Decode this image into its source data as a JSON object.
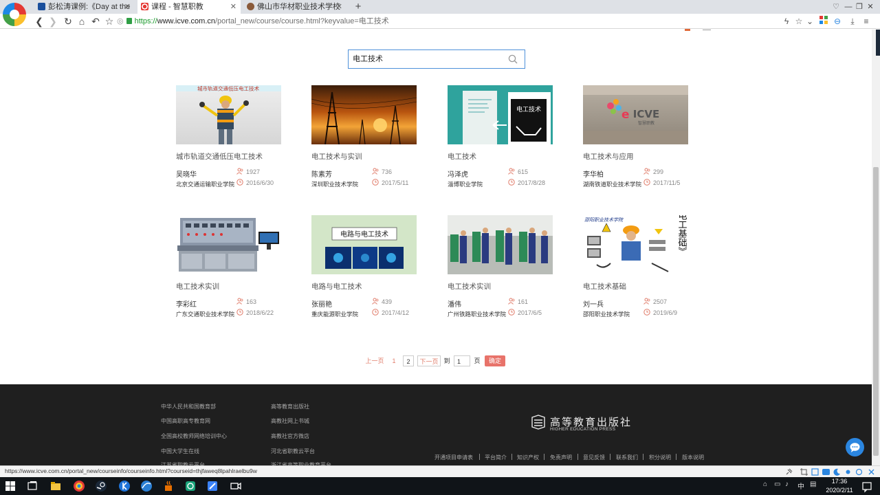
{
  "browser": {
    "tabs": [
      {
        "label": "彭松涛课例:《Day at the",
        "active": false
      },
      {
        "label": "课程 - 智慧职教",
        "active": true
      },
      {
        "label": "佛山市华材职业技术学校",
        "active": false
      }
    ],
    "url": {
      "scheme": "https://",
      "host": "www.icve.com.cn",
      "path": "/portal_new/course/course.html?keyvalue=电工技术"
    },
    "status_url": "https://www.icve.com.cn/portal_new/courseinfo/courseinfo.html?courseid=thjfaweq8lpahlraelbu9w"
  },
  "search": {
    "value": "电工技术"
  },
  "courses": [
    {
      "title": "城市轨道交通低压电工技术",
      "teacher": "吴晓华",
      "school": "北京交通运输职业学院",
      "views": "1927",
      "date": "2016/6/30",
      "banner": "城市轨道交通低压电工技术"
    },
    {
      "title": "电工技术与实训",
      "teacher": "陈素芳",
      "school": "深圳职业技术学院",
      "views": "736",
      "date": "2017/5/11"
    },
    {
      "title": "电工技术",
      "teacher": "冯泽虎",
      "school": "淄博职业学院",
      "views": "615",
      "date": "2017/8/28",
      "cover_text": "电工技术"
    },
    {
      "title": "电工技术与应用",
      "teacher": "李华柏",
      "school": "湖南铁道职业技术学院",
      "views": "299",
      "date": "2017/11/5",
      "logo_text": "ICVE",
      "logo_sub": "智慧职教"
    },
    {
      "title": "电工技术实训",
      "teacher": "李彩红",
      "school": "广东交通职业技术学院",
      "views": "163",
      "date": "2018/6/22"
    },
    {
      "title": "电路与电工技术",
      "teacher": "张丽艳",
      "school": "重庆能源职业学院",
      "views": "439",
      "date": "2017/4/12",
      "cover_text": "电路与电工技术"
    },
    {
      "title": "电工技术实训",
      "teacher": "潘伟",
      "school": "广州铁路职业技术学院",
      "views": "161",
      "date": "2017/6/5"
    },
    {
      "title": "电工技术基础",
      "teacher": "刘一兵",
      "school": "邵阳职业技术学院",
      "views": "2507",
      "date": "2019/6/9",
      "cover_text": "《电工基础》",
      "cover_header": "邵阳职业技术学院"
    }
  ],
  "pagination": {
    "prev": "上一页",
    "current": "1",
    "page2": "2",
    "next": "下一页",
    "to": "到",
    "input": "1",
    "page_unit": "页",
    "go": "确定"
  },
  "footer": {
    "col1": [
      "中华人民共和国教育部",
      "中国高职高专教育网",
      "全国高校教师网络培训中心",
      "中国大学生在线",
      "江苏省职教云平台"
    ],
    "col2": [
      "高等教育出版社",
      "高教社网上书城",
      "高教社官方微店",
      "河北省职教云平台",
      "浙江省高等职业教育平台"
    ],
    "publisher_cn": "高等教育出版社",
    "publisher_en": "HIGHER EDUCATION PRESS",
    "bottom_links": [
      "开通项目申请表",
      "平台简介",
      "知识产权",
      "免责声明",
      "意见反馈",
      "联系我们",
      "积分说明",
      "版本说明"
    ]
  },
  "taskbar": {
    "time": "17:36",
    "date": "2020/2/11",
    "ime": "中"
  },
  "colors": {
    "accent": "#e8736a",
    "link_red": "#e07c6a",
    "search_border": "#4d90d9",
    "footer_bg": "#1f1f1f"
  }
}
